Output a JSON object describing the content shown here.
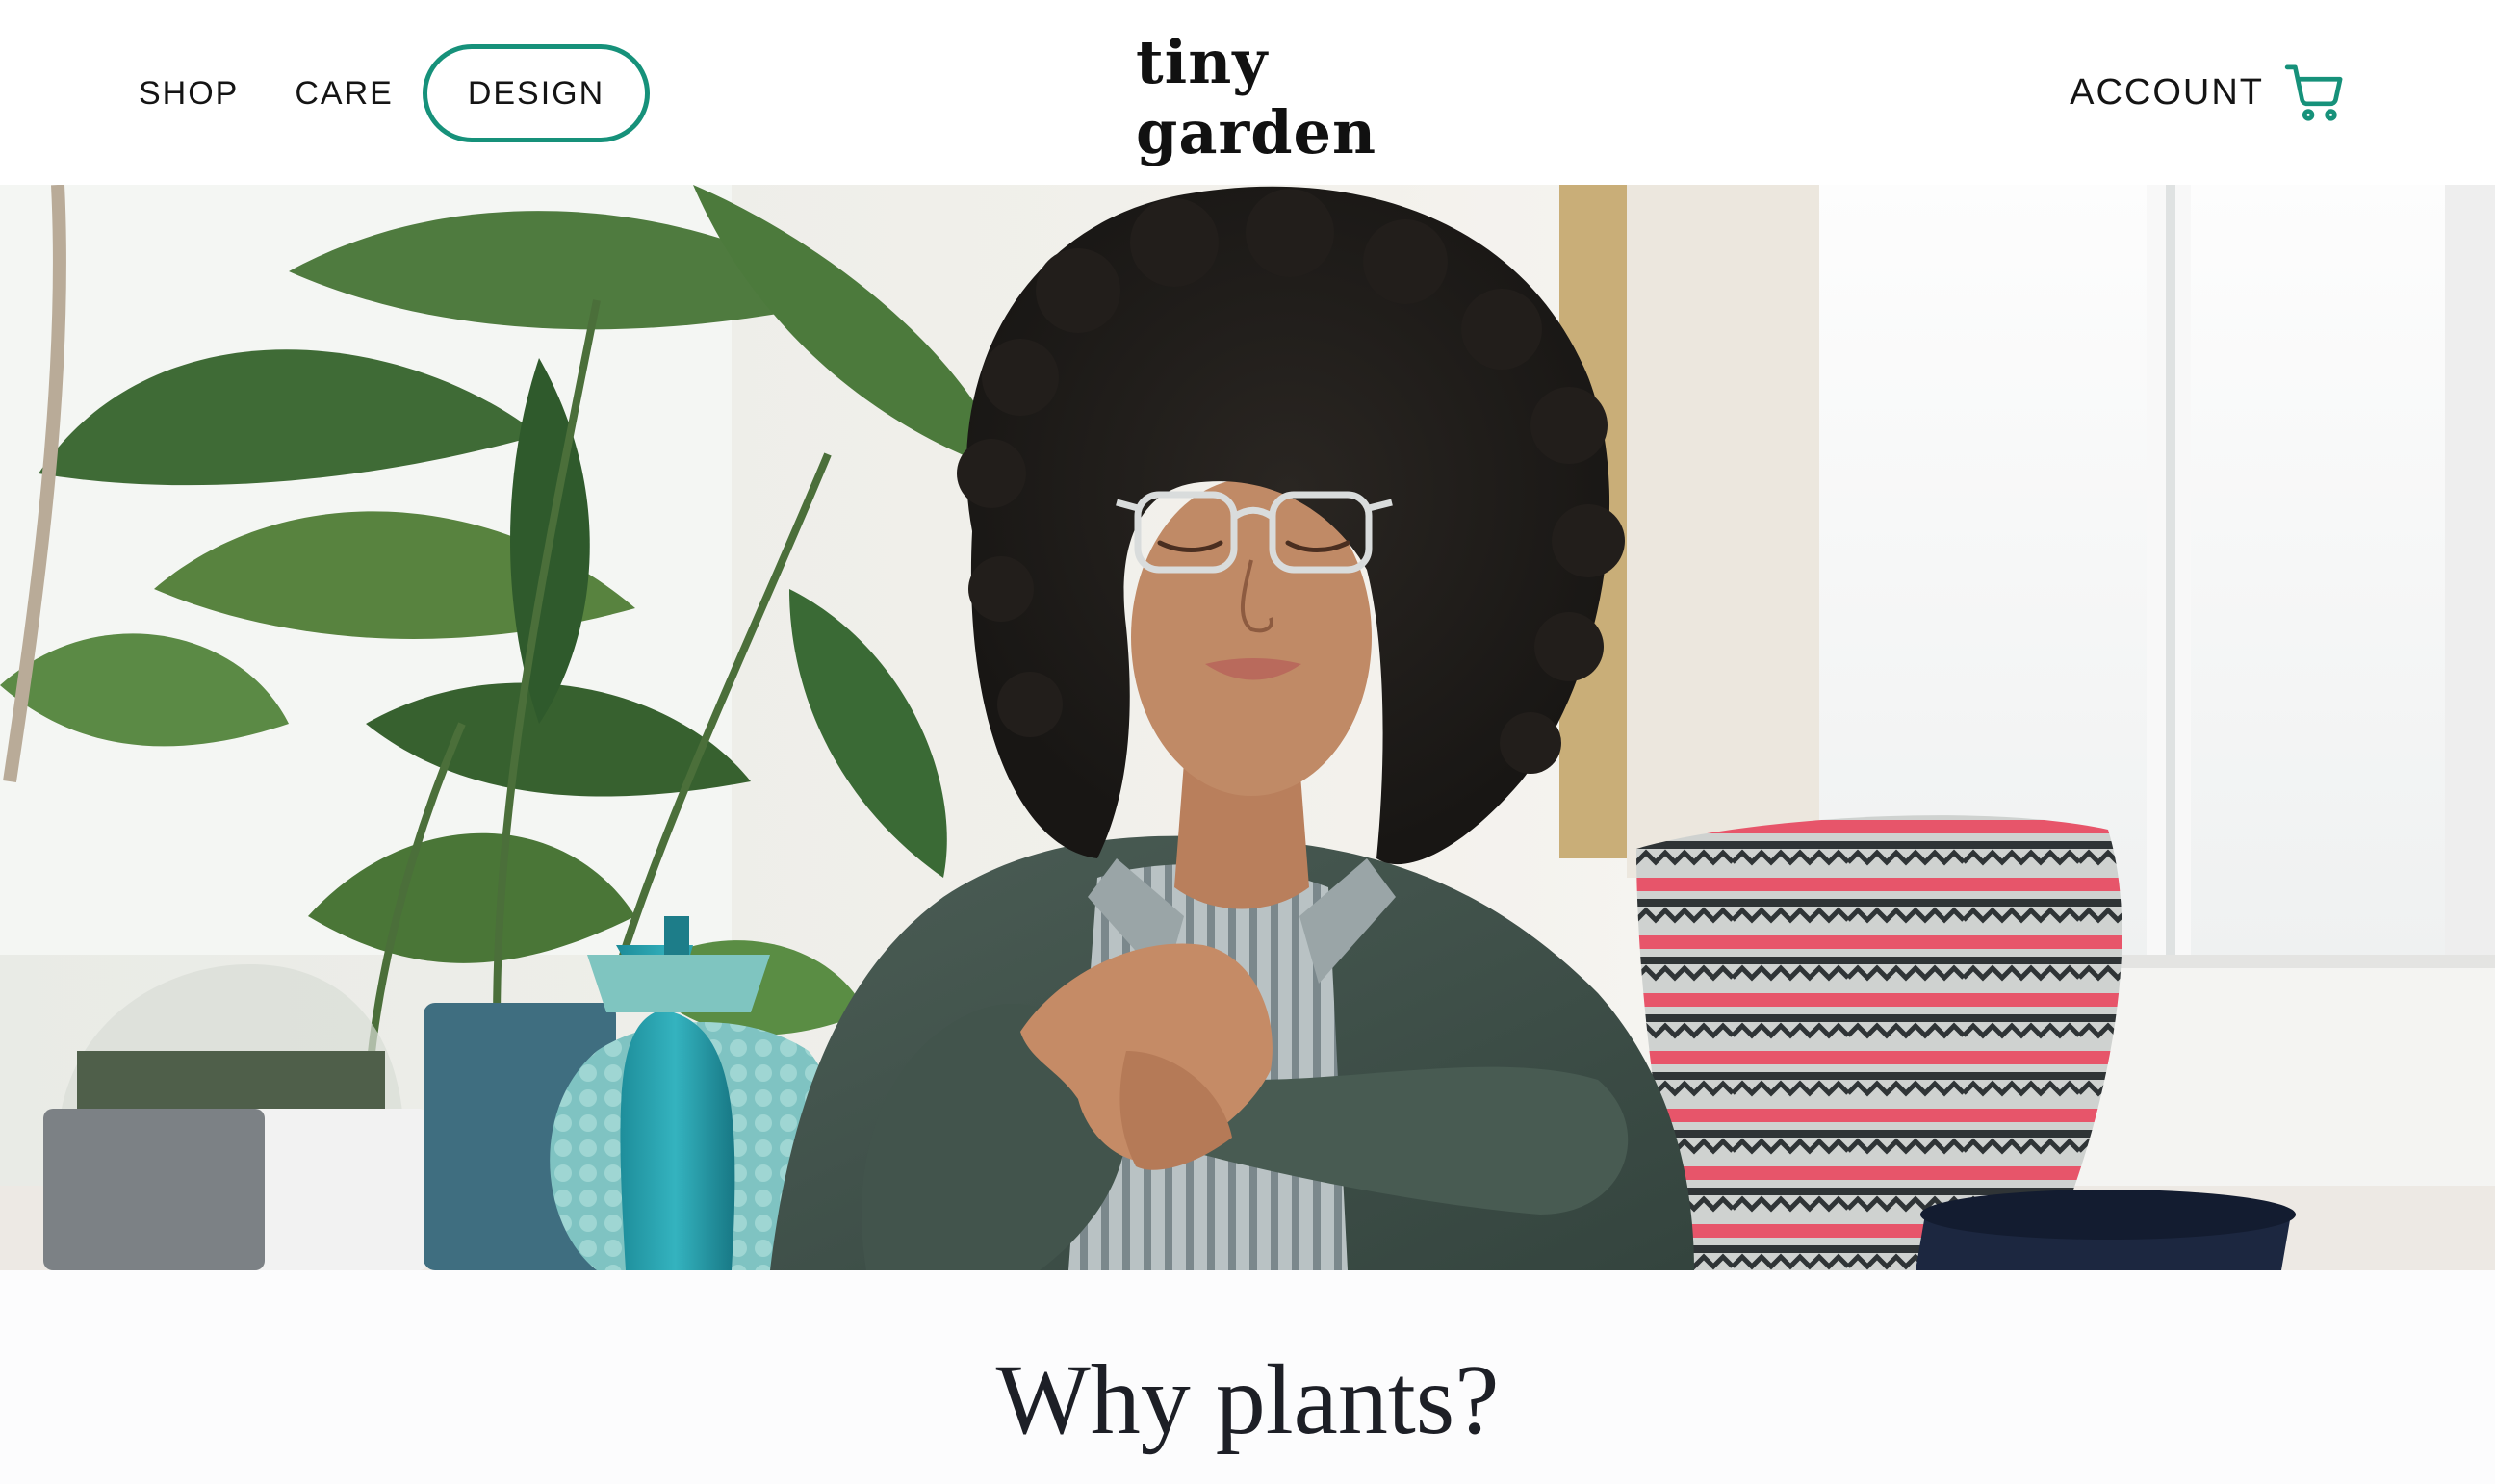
{
  "header": {
    "nav": [
      {
        "label": "SHOP"
      },
      {
        "label": "CARE"
      },
      {
        "label": "DESIGN"
      }
    ],
    "logo": "tiny garden",
    "account_label": "ACCOUNT",
    "cart_icon": "shopping-cart-icon"
  },
  "hero": {
    "image": "photo-woman-with-glasses-among-houseplants"
  },
  "section": {
    "title": "Why plants?"
  },
  "colors": {
    "accent": "#16917a",
    "text": "#141414",
    "background": "#fcfcfd"
  }
}
